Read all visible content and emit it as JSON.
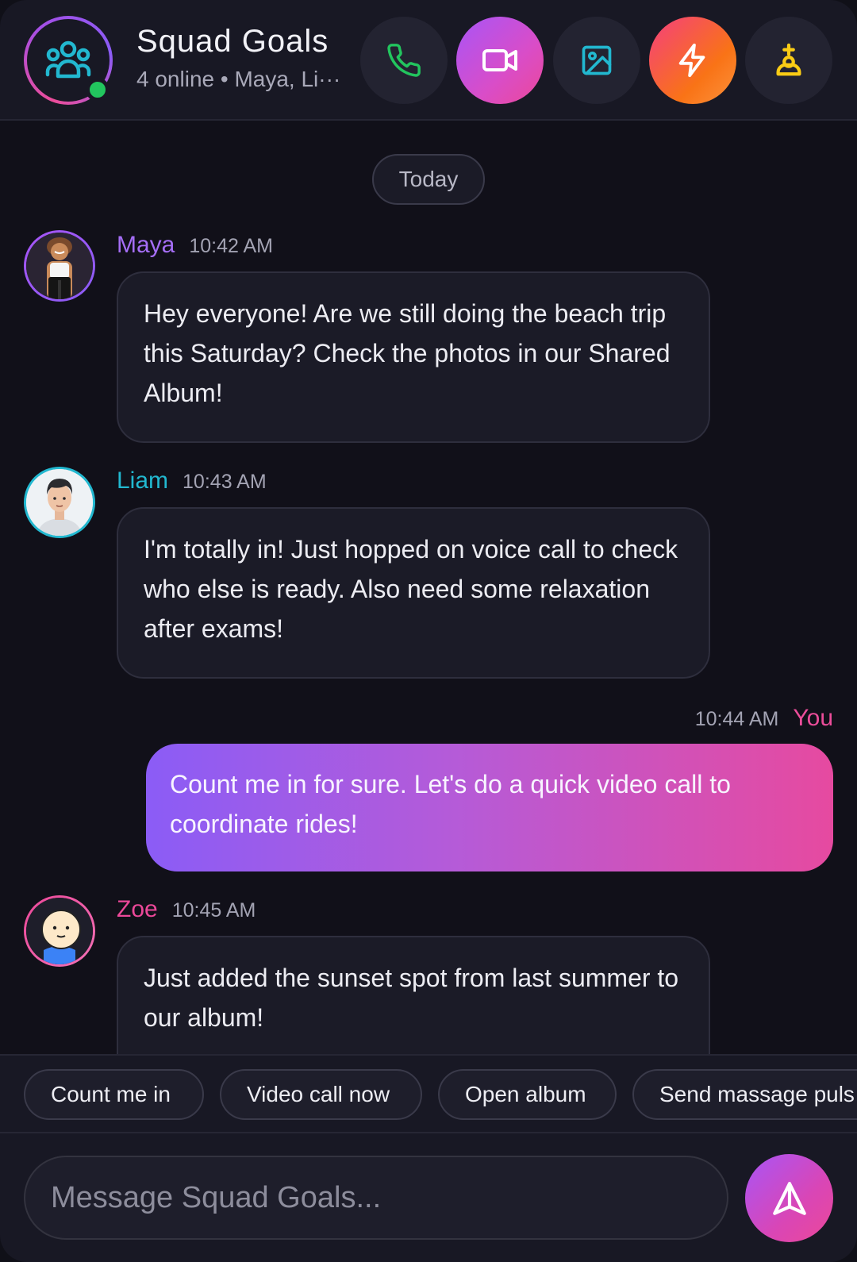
{
  "header": {
    "title": "Squad Goals",
    "subtitle": "4 online • Maya, Li···",
    "online_color": "#22c55e",
    "icons": {
      "group": "group-icon",
      "call": "phone-icon",
      "video": "video-camera-icon",
      "album": "image-icon",
      "bolt": "lightning-icon",
      "add": "add-user-icon"
    }
  },
  "chat": {
    "date_label": "Today",
    "messages": [
      {
        "sender": "Maya",
        "time": "10:42 AM",
        "text": "Hey everyone! Are we still doing the beach trip this Saturday? Check the photos in our Shared Album!",
        "accent": "#a56ef6"
      },
      {
        "sender": "Liam",
        "time": "10:43 AM",
        "text": "I'm totally in! Just hopped on voice call to check who else is ready. Also need some relaxation after exams!",
        "accent": "#22b8d0"
      },
      {
        "sender": "You",
        "time": "10:44 AM",
        "text": "Count me in for sure. Let's do a quick video call to coordinate rides!",
        "accent": "#ec4d9a"
      },
      {
        "sender": "Zoe",
        "time": "10:45 AM",
        "text": "Just added the sunset spot from last summer to our album!",
        "accent": "#ec4899"
      }
    ]
  },
  "quick_replies": [
    "Count me in",
    "Video call now",
    "Open album",
    "Send massage puls"
  ],
  "composer": {
    "placeholder": "Message Squad Goals...",
    "send_icon": "send-icon"
  }
}
